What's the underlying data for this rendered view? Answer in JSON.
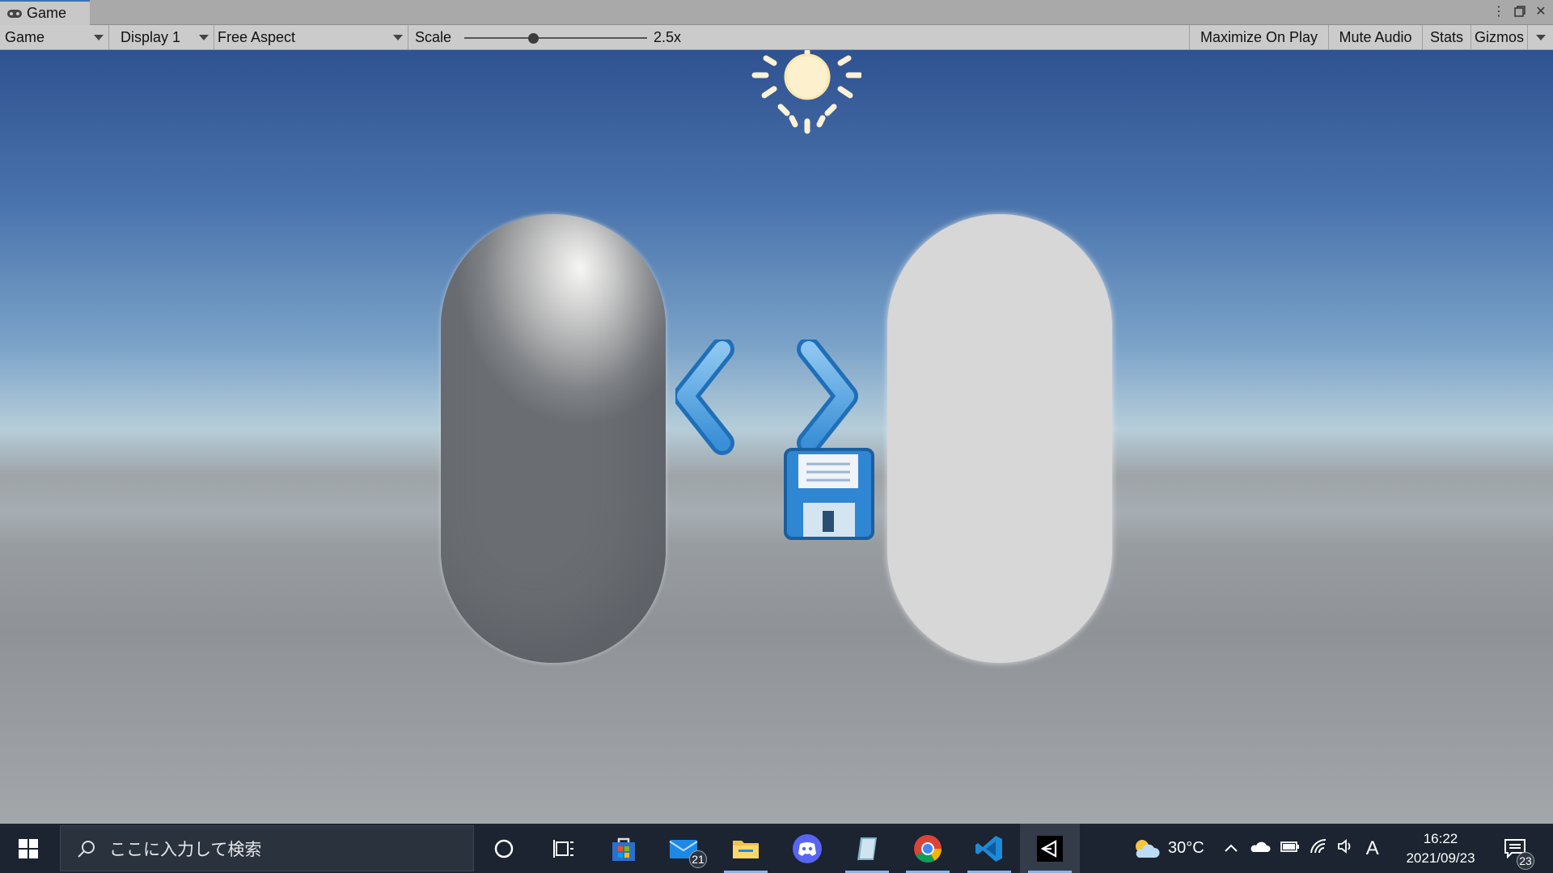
{
  "tab": {
    "label": "Game"
  },
  "toolbar": {
    "view_mode": "Game",
    "display": "Display 1",
    "aspect": "Free Aspect",
    "scale_label": "Scale",
    "scale_value": "2.5x",
    "scale_fraction": 0.38,
    "maximize_on_play": "Maximize On Play",
    "mute_audio": "Mute Audio",
    "stats": "Stats",
    "gizmos": "Gizmos"
  },
  "colors": {
    "accent": "#3a72b0",
    "taskbar": "#1b2430",
    "sky_top": "#2f5290",
    "ground": "#8f9398"
  },
  "taskbar": {
    "search_placeholder": "ここに入力して検索",
    "mail_badge": "21",
    "weather_temp": "30°C",
    "ime_label": "A",
    "time": "16:22",
    "date": "2021/09/23",
    "notifications_badge": "23"
  }
}
